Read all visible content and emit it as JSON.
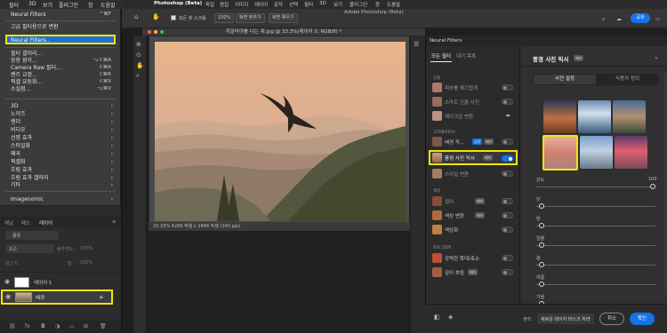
{
  "left_menubar": {
    "items": [
      "필터",
      "3D",
      "보기",
      "플러그인",
      "창",
      "도움말"
    ]
  },
  "filter_menu": {
    "last_filter": "Neural Filters",
    "last_filter_shortcut": "^⌘F",
    "convert_smart": "고급 필터용으로 변환",
    "neural_filters": "Neural Filters...",
    "filter_gallery": "필터 갤러리...",
    "adaptive_wide": "응용 광각...",
    "adaptive_wide_shortcut": "⌥⇧⌘A",
    "camera_raw": "Camera Raw 필터...",
    "camera_raw_shortcut": "⇧⌘A",
    "lens_correction": "렌즈 교정...",
    "lens_correction_shortcut": "⇧⌘R",
    "liquify": "픽셀 유동화...",
    "liquify_shortcut": "⇧⌘X",
    "vanishing_point": "소실점...",
    "vanishing_point_shortcut": "⌥⌘V",
    "submenus": [
      "3D",
      "노이즈",
      "렌더",
      "비디오",
      "선명 효과",
      "스타일화",
      "왜곡",
      "픽셀화",
      "흐림 효과",
      "흐림 효과 갤러리",
      "기타"
    ],
    "imagenomic": "Imagenomic"
  },
  "layers_panel": {
    "tabs": [
      "채널",
      "패스",
      "레이어"
    ],
    "filter_label": "종류",
    "blend_mode": "표준",
    "opacity_label": "불투명도:",
    "opacity_value": "100%",
    "lock_label": "잠그기:",
    "fill_label": "칠:",
    "fill_value": "100%",
    "layers": [
      {
        "name": "레이어 1"
      },
      {
        "name": "배경"
      }
    ]
  },
  "app": {
    "name": "Photoshop (Beta)",
    "menu": [
      "파일",
      "편집",
      "이미지",
      "레이어",
      "문자",
      "선택",
      "필터",
      "3D",
      "보기",
      "플러그인",
      "창",
      "도움말"
    ],
    "window_title": "Adobe Photoshop (Beta)",
    "document_tab": "히말라야를 나는 새.jpg @ 33.3%(레이어 0, RGB/8) *",
    "status": "33.33%     4288 픽셀 x 2848 픽셀 (240 ppi)"
  },
  "options_bar": {
    "all_layers": "모든 창 스크롤",
    "zoom": "100%",
    "fit_screen": "화면 맞추기",
    "fill_screen": "화면 채우기"
  },
  "neural_filters": {
    "header": "Neural Filters",
    "tab_all": "모든 필터",
    "tab_waitlist": "대기 목록",
    "sections": [
      {
        "title": "인물",
        "items": [
          {
            "label": "피부를 매끄럽게",
            "enabled": false
          },
          {
            "label": "스마트 인물 사진",
            "enabled": false
          },
          {
            "label": "메이크업 변환",
            "enabled": false
          }
        ]
      },
      {
        "title": "크리에이티브",
        "items": [
          {
            "label": "배경 작...",
            "badge1": "신규",
            "badge2": "베타",
            "enabled": false
          },
          {
            "label": "풍경 사진 믹서",
            "badge1": "베타",
            "enabled": true
          },
          {
            "label": "스타일 변환",
            "enabled": false
          }
        ]
      },
      {
        "title": "색상",
        "items": [
          {
            "label": "컬러",
            "badge1": "베타",
            "enabled": false
          },
          {
            "label": "색상 변환",
            "badge1": "베타",
            "enabled": false
          },
          {
            "label": "색상화",
            "enabled": false
          }
        ]
      },
      {
        "title": "포토그래피",
        "items": [
          {
            "label": "강력한 확대/축소",
            "enabled": false
          },
          {
            "label": "깊이 흐림",
            "badge1": "베타",
            "enabled": false
          }
        ]
      }
    ],
    "detail": {
      "title": "풍경 사진 믹서",
      "badge": "베타",
      "tab_presets": "사전 설정",
      "tab_custom": "사용자 정의",
      "sliders": [
        {
          "label": "강도",
          "value": "100",
          "level": 1.0
        },
        {
          "label": "낮",
          "value": "",
          "level": 0.02
        },
        {
          "label": "밤",
          "value": "",
          "level": 0.02
        },
        {
          "label": "일몰",
          "value": "",
          "level": 0.02
        },
        {
          "label": "봄",
          "value": "",
          "level": 0.02
        },
        {
          "label": "여름",
          "value": "",
          "level": 0.02
        },
        {
          "label": "가을",
          "value": "",
          "level": 0.02
        }
      ]
    },
    "footer": {
      "output_label": "출력",
      "output_value": "새로운 레이어 마스크 처리",
      "cancel": "취소",
      "ok": "확인"
    }
  },
  "colors": {
    "accent": "#1473e6",
    "highlight": "#f2e600"
  }
}
